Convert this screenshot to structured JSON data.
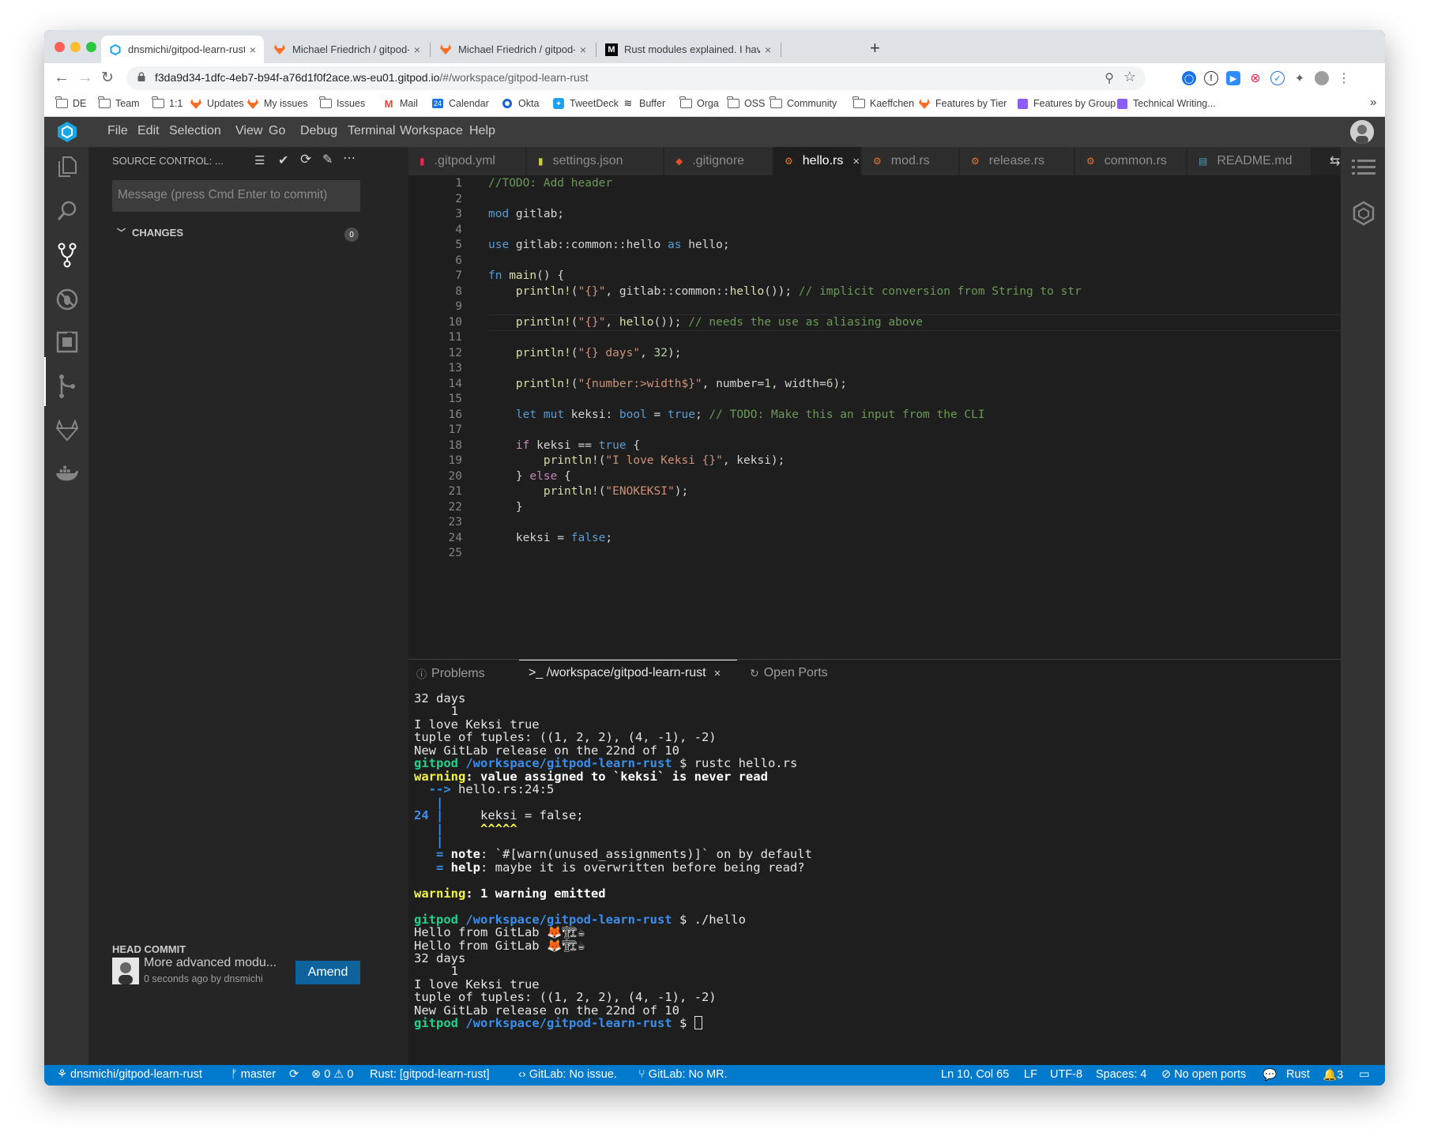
{
  "browser": {
    "tabs": [
      {
        "label": "dnsmichi/gitpod-learn-rust - m",
        "active": true
      },
      {
        "label": "Michael Friedrich / gitpod-learn",
        "active": false
      },
      {
        "label": "Michael Friedrich / gitpod-learn",
        "active": false
      },
      {
        "label": "Rust modules explained. I have",
        "active": false
      }
    ],
    "url_host": "f3da9d34-1dfc-4eb7-b94f-a76d1f0f2ace.ws-eu01.gitpod.io",
    "url_path": "/#/workspace/gitpod-learn-rust",
    "bookmarks": [
      "DE",
      "Team",
      "1:1",
      "Updates",
      "My issues",
      "Issues",
      "Mail",
      "Calendar",
      "Okta",
      "TweetDeck",
      "Buffer",
      "Orga",
      "OSS",
      "Community",
      "Kaeffchen",
      "Features by Tier",
      "Features by Group",
      "Technical Writing..."
    ],
    "bookmarks_more": "»",
    "calendar_day": "24",
    "colors": {
      "accent": "#007acc",
      "gitlab": "#fc6d26"
    }
  },
  "ide": {
    "menu": [
      "File",
      "Edit",
      "Selection",
      "View",
      "Go",
      "Debug",
      "Terminal",
      "Workspace",
      "Help"
    ],
    "sidebar": {
      "title": "SOURCE CONTROL: ...",
      "commit_placeholder": "Message (press Cmd Enter to commit)",
      "changes_label": "CHANGES",
      "changes_count": "0",
      "head_commit_label": "HEAD COMMIT",
      "head_commit_message": "More advanced modu...",
      "head_commit_meta": "0 seconds ago by dnsmichi",
      "amend_label": "Amend"
    },
    "editor_tabs": [
      {
        "label": ".gitpod.yml",
        "icon": "yaml-icon",
        "color": "#e8274b",
        "active": false
      },
      {
        "label": "settings.json",
        "icon": "json-icon",
        "color": "#cbcb41",
        "active": false
      },
      {
        "label": ".gitignore",
        "icon": "git-icon",
        "color": "#e44d26",
        "active": false
      },
      {
        "label": "hello.rs",
        "icon": "rust-icon",
        "color": "#e37933",
        "active": true
      },
      {
        "label": "mod.rs",
        "icon": "rust-icon",
        "color": "#e37933",
        "active": false
      },
      {
        "label": "release.rs",
        "icon": "rust-icon",
        "color": "#e37933",
        "active": false
      },
      {
        "label": "common.rs",
        "icon": "rust-icon",
        "color": "#e37933",
        "active": false
      },
      {
        "label": "README.md",
        "icon": "markdown-icon",
        "color": "#519aba",
        "active": false
      }
    ],
    "code_lines": [
      [
        {
          "t": "//TODO: Add header",
          "c": "com"
        }
      ],
      [],
      [
        {
          "t": "mod",
          "c": "kw"
        },
        {
          "t": " gitlab;",
          "c": ""
        }
      ],
      [],
      [
        {
          "t": "use",
          "c": "kw"
        },
        {
          "t": " gitlab::common::hello ",
          "c": ""
        },
        {
          "t": "as",
          "c": "kw"
        },
        {
          "t": " hello;",
          "c": ""
        }
      ],
      [],
      [
        {
          "t": "fn",
          "c": "kw"
        },
        {
          "t": " ",
          "c": ""
        },
        {
          "t": "main",
          "c": "fn"
        },
        {
          "t": "() {",
          "c": ""
        }
      ],
      [
        {
          "t": "    ",
          "c": ""
        },
        {
          "t": "println!",
          "c": "fn"
        },
        {
          "t": "(",
          "c": ""
        },
        {
          "t": "\"{}\"",
          "c": "str"
        },
        {
          "t": ", gitlab::common::",
          "c": ""
        },
        {
          "t": "hello",
          "c": "fn"
        },
        {
          "t": "()); ",
          "c": ""
        },
        {
          "t": "// implicit conversion from String to str",
          "c": "com"
        }
      ],
      [],
      [
        {
          "t": "    ",
          "c": ""
        },
        {
          "t": "println!",
          "c": "fn"
        },
        {
          "t": "(",
          "c": ""
        },
        {
          "t": "\"{}\"",
          "c": "str"
        },
        {
          "t": ", ",
          "c": ""
        },
        {
          "t": "hello",
          "c": "fn"
        },
        {
          "t": "()); ",
          "c": ""
        },
        {
          "t": "// needs the use as aliasing above",
          "c": "com"
        }
      ],
      [],
      [
        {
          "t": "    ",
          "c": ""
        },
        {
          "t": "println!",
          "c": "fn"
        },
        {
          "t": "(",
          "c": ""
        },
        {
          "t": "\"{} days\"",
          "c": "str"
        },
        {
          "t": ", ",
          "c": ""
        },
        {
          "t": "32",
          "c": "num"
        },
        {
          "t": ");",
          "c": ""
        }
      ],
      [],
      [
        {
          "t": "    ",
          "c": ""
        },
        {
          "t": "println!",
          "c": "fn"
        },
        {
          "t": "(",
          "c": ""
        },
        {
          "t": "\"{number:>width$}\"",
          "c": "str"
        },
        {
          "t": ", number=",
          "c": ""
        },
        {
          "t": "1",
          "c": "num"
        },
        {
          "t": ", width=",
          "c": ""
        },
        {
          "t": "6",
          "c": "num"
        },
        {
          "t": ");",
          "c": ""
        }
      ],
      [],
      [
        {
          "t": "    ",
          "c": ""
        },
        {
          "t": "let",
          "c": "kw"
        },
        {
          "t": " ",
          "c": ""
        },
        {
          "t": "mut",
          "c": "kw"
        },
        {
          "t": " keksi: ",
          "c": ""
        },
        {
          "t": "bool",
          "c": "kw"
        },
        {
          "t": " = ",
          "c": ""
        },
        {
          "t": "true",
          "c": "kw"
        },
        {
          "t": "; ",
          "c": ""
        },
        {
          "t": "// TODO: Make this an input from the CLI",
          "c": "com"
        }
      ],
      [],
      [
        {
          "t": "    ",
          "c": ""
        },
        {
          "t": "if",
          "c": "ctl"
        },
        {
          "t": " keksi == ",
          "c": ""
        },
        {
          "t": "true",
          "c": "kw"
        },
        {
          "t": " {",
          "c": ""
        }
      ],
      [
        {
          "t": "        ",
          "c": ""
        },
        {
          "t": "println!",
          "c": "fn"
        },
        {
          "t": "(",
          "c": ""
        },
        {
          "t": "\"I love Keksi {}\"",
          "c": "str"
        },
        {
          "t": ", keksi);",
          "c": ""
        }
      ],
      [
        {
          "t": "    } ",
          "c": ""
        },
        {
          "t": "else",
          "c": "ctl"
        },
        {
          "t": " {",
          "c": ""
        }
      ],
      [
        {
          "t": "        ",
          "c": ""
        },
        {
          "t": "println!",
          "c": "fn"
        },
        {
          "t": "(",
          "c": ""
        },
        {
          "t": "\"ENOKEKSI\"",
          "c": "str"
        },
        {
          "t": ");",
          "c": ""
        }
      ],
      [
        {
          "t": "    }",
          "c": ""
        }
      ],
      [],
      [
        {
          "t": "    keksi = ",
          "c": ""
        },
        {
          "t": "false",
          "c": "kw"
        },
        {
          "t": ";",
          "c": ""
        }
      ],
      []
    ],
    "panel_tabs": {
      "problems": "Problems",
      "terminal": ">_ /workspace/gitpod-learn-rust",
      "ports": "Open Ports"
    },
    "terminal_lines": [
      [
        {
          "t": "32 days",
          "c": ""
        }
      ],
      [
        {
          "t": "     1",
          "c": ""
        }
      ],
      [
        {
          "t": "I love Keksi true",
          "c": ""
        }
      ],
      [
        {
          "t": "tuple of tuples: ((1, 2, 2), (4, -1), -2)",
          "c": ""
        }
      ],
      [
        {
          "t": "New GitLab release on the 22nd of 10",
          "c": ""
        }
      ],
      [
        {
          "t": "gitpod",
          "c": "grn"
        },
        {
          "t": " ",
          "c": ""
        },
        {
          "t": "/workspace/gitpod-learn-rust",
          "c": "blu"
        },
        {
          "t": " $ rustc hello.rs",
          "c": ""
        }
      ],
      [
        {
          "t": "warning",
          "c": "yel"
        },
        {
          "t": ": value assigned to `keksi` is never read",
          "c": "bold"
        }
      ],
      [
        {
          "t": "  -->",
          "c": "blu"
        },
        {
          "t": " hello.rs:24:5",
          "c": ""
        }
      ],
      [
        {
          "t": "   |",
          "c": "blu"
        }
      ],
      [
        {
          "t": "24 |",
          "c": "blu"
        },
        {
          "t": "     keksi = false;",
          "c": ""
        }
      ],
      [
        {
          "t": "   |",
          "c": "blu"
        },
        {
          "t": "     ^^^^^",
          "c": "yel"
        }
      ],
      [
        {
          "t": "   |",
          "c": "blu"
        }
      ],
      [
        {
          "t": "   =",
          "c": "blu"
        },
        {
          "t": " note",
          "c": "bold"
        },
        {
          "t": ": `#[warn(unused_assignments)]` on by default",
          "c": ""
        }
      ],
      [
        {
          "t": "   =",
          "c": "blu"
        },
        {
          "t": " help",
          "c": "bold"
        },
        {
          "t": ": maybe it is overwritten before being read?",
          "c": ""
        }
      ],
      [],
      [
        {
          "t": "warning",
          "c": "yel"
        },
        {
          "t": ": 1 warning emitted",
          "c": "bold"
        }
      ],
      [],
      [
        {
          "t": "gitpod",
          "c": "grn"
        },
        {
          "t": " ",
          "c": ""
        },
        {
          "t": "/workspace/gitpod-learn-rust",
          "c": "blu"
        },
        {
          "t": " $ ./hello",
          "c": ""
        }
      ],
      [
        {
          "t": "Hello from GitLab 🦊🏗☕",
          "c": ""
        }
      ],
      [
        {
          "t": "Hello from GitLab 🦊🏗☕",
          "c": ""
        }
      ],
      [
        {
          "t": "32 days",
          "c": ""
        }
      ],
      [
        {
          "t": "     1",
          "c": ""
        }
      ],
      [
        {
          "t": "I love Keksi true",
          "c": ""
        }
      ],
      [
        {
          "t": "tuple of tuples: ((1, 2, 2), (4, -1), -2)",
          "c": ""
        }
      ],
      [
        {
          "t": "New GitLab release on the 22nd of 10",
          "c": ""
        }
      ],
      [
        {
          "t": "gitpod",
          "c": "grn"
        },
        {
          "t": " ",
          "c": ""
        },
        {
          "t": "/workspace/gitpod-learn-rust",
          "c": "blu"
        },
        {
          "t": " $ ",
          "c": ""
        },
        {
          "t": "",
          "c": "cursor"
        }
      ]
    ],
    "status": {
      "repo": "dnsmichi/gitpod-learn-rust",
      "branch": "master",
      "errors": "0",
      "warnings": "0",
      "rust": "Rust: [gitpod-learn-rust]",
      "gitlab_issue": "GitLab: No issue.",
      "gitlab_mr": "GitLab: No MR.",
      "position": "Ln 10, Col 65",
      "eol": "LF",
      "encoding": "UTF-8",
      "spaces": "Spaces: 4",
      "ports": "No open ports",
      "language": "Rust",
      "notifications": "3"
    }
  }
}
